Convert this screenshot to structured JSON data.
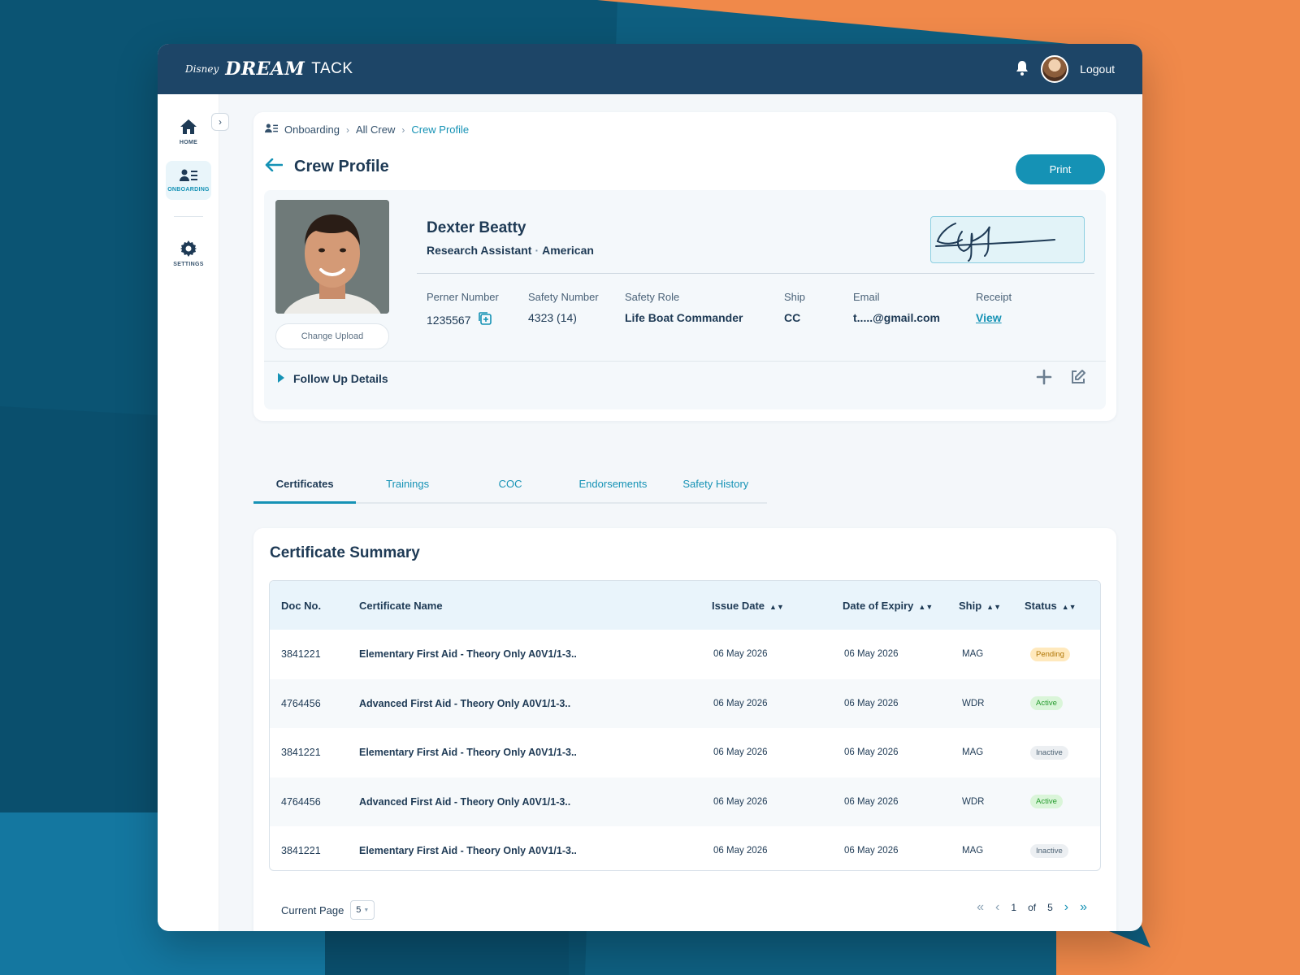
{
  "header": {
    "brand_small": "Disney",
    "brand_main": "DREAM",
    "brand_suffix": "TACK",
    "logout_label": "Logout"
  },
  "sidebar": {
    "items": [
      {
        "label": "HOME",
        "icon": "home-icon"
      },
      {
        "label": "ONBOARDING",
        "icon": "onboarding-icon"
      },
      {
        "label": "SETTINGS",
        "icon": "gear-icon"
      }
    ]
  },
  "breadcrumb": [
    "Onboarding",
    "All Crew",
    "Crew Profile"
  ],
  "page": {
    "title": "Crew Profile",
    "print_label": "Print"
  },
  "profile": {
    "name": "Dexter Beatty",
    "role": "Research Assistant",
    "nationality": "American",
    "change_upload_label": "Change Upload",
    "fields": [
      {
        "label": "Perner Number",
        "value": "1235567"
      },
      {
        "label": "Safety Number",
        "value": "4323 (14)"
      },
      {
        "label": "Safety Role",
        "value": "Life Boat Commander"
      },
      {
        "label": "Ship",
        "value": "CC"
      },
      {
        "label": "Email",
        "value": "t.....@gmail.com"
      },
      {
        "label": "Receipt",
        "value": "View"
      }
    ],
    "follow_up_label": "Follow Up Details"
  },
  "tabs": [
    "Certificates",
    "Trainings",
    "COC",
    "Endorsements",
    "Safety History"
  ],
  "summary": {
    "title": "Certificate Summary",
    "columns": [
      "Doc No.",
      "Certificate Name",
      "Issue Date",
      "Date of Expiry",
      "Ship",
      "Status"
    ],
    "rows": [
      {
        "doc": "3841221",
        "name": "Elementary First Aid - Theory Only A0V1/1-3..",
        "issue": "06 May 2026",
        "expiry": "06 May 2026",
        "ship": "MAG",
        "status": "Pending"
      },
      {
        "doc": "4764456",
        "name": "Advanced First Aid - Theory Only A0V1/1-3..",
        "issue": "06 May 2026",
        "expiry": "06 May 2026",
        "ship": "WDR",
        "status": "Active"
      },
      {
        "doc": "3841221",
        "name": "Elementary First Aid - Theory Only A0V1/1-3..",
        "issue": "06 May 2026",
        "expiry": "06 May 2026",
        "ship": "MAG",
        "status": "Inactive"
      },
      {
        "doc": "4764456",
        "name": "Advanced First Aid - Theory Only A0V1/1-3..",
        "issue": "06 May 2026",
        "expiry": "06 May 2026",
        "ship": "WDR",
        "status": "Active"
      },
      {
        "doc": "3841221",
        "name": "Elementary First Aid - Theory Only A0V1/1-3..",
        "issue": "06 May 2026",
        "expiry": "06 May 2026",
        "ship": "MAG",
        "status": "Inactive"
      }
    ]
  },
  "pagination": {
    "current_page_label": "Current Page",
    "page_size": "5",
    "page": "1",
    "of_label": "of",
    "total_pages": "5"
  },
  "colors": {
    "accent": "#1592b5",
    "navy": "#1d4567",
    "pending_bg": "#ffe9bd",
    "active_bg": "#daf5d9",
    "inactive_bg": "#eceff2"
  }
}
